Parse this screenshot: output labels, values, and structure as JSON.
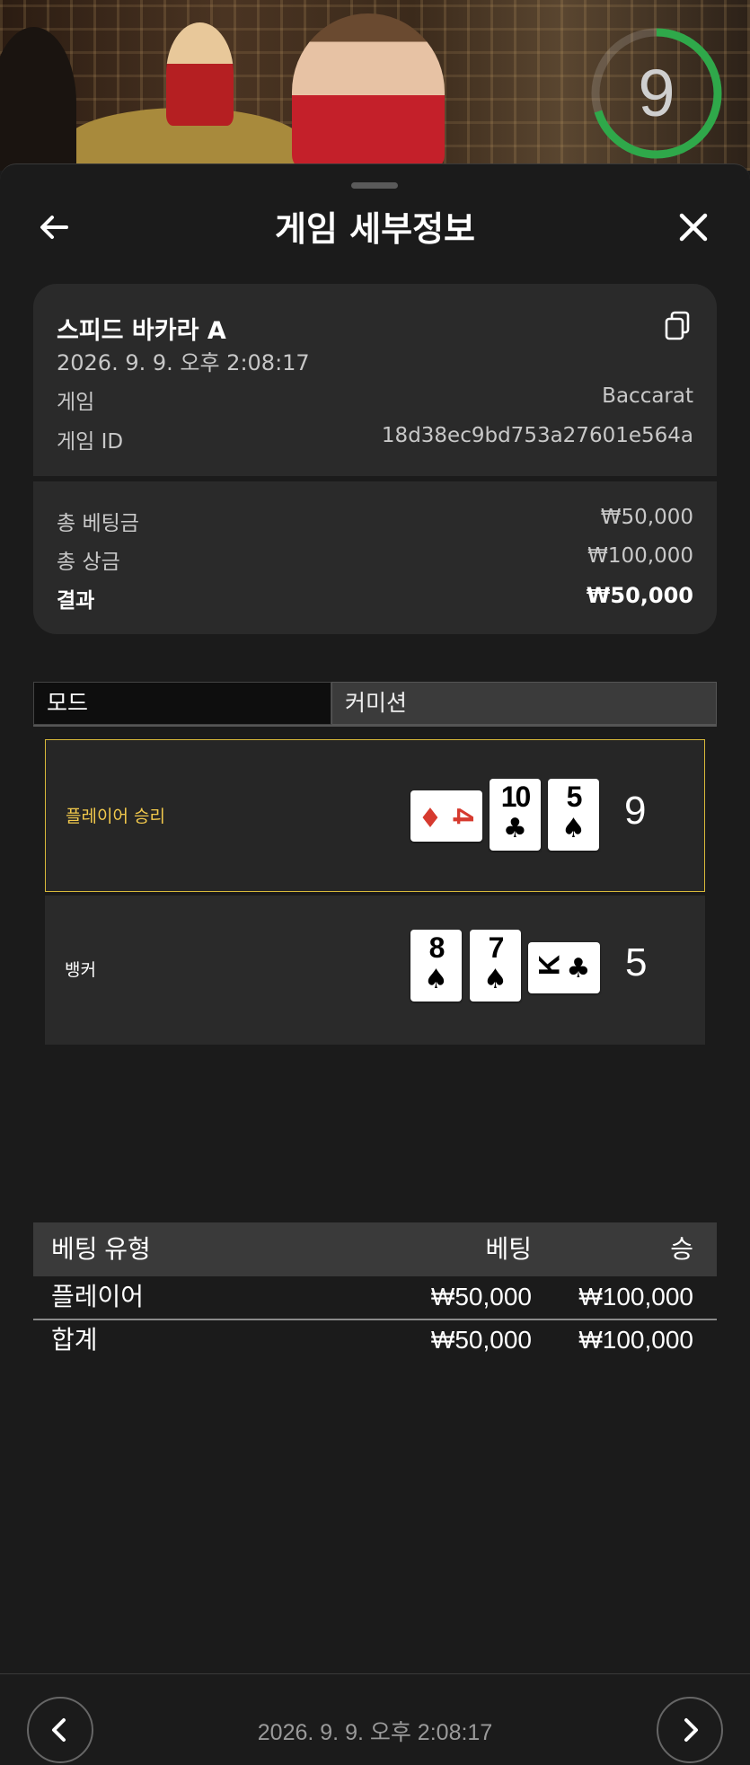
{
  "timer": {
    "value": "9",
    "ring_color": "#2fa84a"
  },
  "header": {
    "title": "게임 세부정보",
    "back_icon": "arrow-left-icon",
    "close_icon": "close-icon"
  },
  "info": {
    "game_title": "스피드 바카라 A",
    "datetime": "2026. 9. 9. 오후 2:08:17",
    "rows": [
      {
        "label": "게임",
        "value": "Baccarat"
      },
      {
        "label": "게임 ID",
        "value": "18d38ec9bd753a27601e564a"
      }
    ],
    "totals": [
      {
        "label": "총 베팅금",
        "value": "₩50,000"
      },
      {
        "label": "총 상금",
        "value": "₩100,000"
      },
      {
        "label": "결과",
        "value": "₩50,000"
      }
    ]
  },
  "tabs": [
    {
      "label": "모드"
    },
    {
      "label": "커미션"
    }
  ],
  "results": {
    "player": {
      "label": "플레이어 승리",
      "score": "9",
      "cards": [
        {
          "rank": "4",
          "suit": "♦",
          "color": "#d63a2f",
          "orientation": "horizontal"
        },
        {
          "rank": "10",
          "suit": "♣",
          "color": "#000000",
          "orientation": "vertical"
        },
        {
          "rank": "5",
          "suit": "♠",
          "color": "#000000",
          "orientation": "vertical"
        }
      ]
    },
    "banker": {
      "label": "뱅커",
      "score": "5",
      "cards": [
        {
          "rank": "8",
          "suit": "♠",
          "color": "#000000",
          "orientation": "vertical"
        },
        {
          "rank": "7",
          "suit": "♠",
          "color": "#000000",
          "orientation": "vertical"
        },
        {
          "rank": "K",
          "suit": "♣",
          "color": "#000000",
          "orientation": "horizontal"
        }
      ]
    },
    "highlight_color": "#f2c94c"
  },
  "bets": {
    "headers": {
      "type": "베팅 유형",
      "bet": "베팅",
      "win": "승"
    },
    "rows": [
      {
        "type": "플레이어",
        "bet": "₩50,000",
        "win": "₩100,000"
      }
    ],
    "total": {
      "type": "합계",
      "bet": "₩50,000",
      "win": "₩100,000"
    }
  },
  "footer": {
    "datetime": "2026. 9. 9. 오후 2:08:17",
    "prev_icon": "chevron-left-icon",
    "next_icon": "chevron-right-icon"
  }
}
